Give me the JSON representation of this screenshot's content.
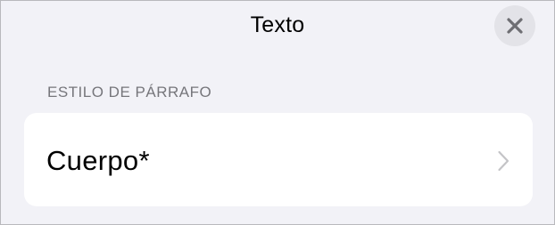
{
  "header": {
    "title": "Texto",
    "close_icon": "close-icon"
  },
  "paragraph_style": {
    "section_label": "ESTILO DE PÁRRAFO",
    "value": "Cuerpo*",
    "disclosure_icon": "chevron-right-icon"
  },
  "colors": {
    "background": "#f2f2f7",
    "card": "#ffffff",
    "secondary_text": "#76767b",
    "close_button_bg": "#e3e3e8",
    "close_glyph": "#6e6e73",
    "chevron": "#c4c4c7"
  }
}
